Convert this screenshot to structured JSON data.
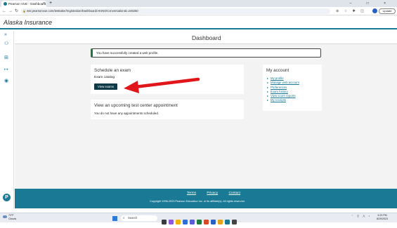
{
  "browser": {
    "tab_title": "Pearson VUE - Dashboard",
    "tab_close": "×",
    "new_tab": "+",
    "window_controls": "–  □  ×",
    "url": "wsr.pearsonvue.com/testtaker/registration/Dashboard/AKINS/ConversationId=246250",
    "update_label": "Update",
    "back": "←",
    "forward": "→",
    "reload": "↻",
    "toolbar_icons": "⊕ ☆ ✱ ◫"
  },
  "header": {
    "brand": "Alaska Insurance"
  },
  "sidebar": {
    "items": [
      "»",
      "⚇",
      "⊞",
      "↦",
      "◉"
    ],
    "logo": "P"
  },
  "page": {
    "title": "Dashboard"
  },
  "alert": {
    "text": "You have successfully created a web profile."
  },
  "schedule": {
    "heading": "Schedule an exam",
    "catalog": "Exam catalog",
    "button": "View exams"
  },
  "upcoming": {
    "heading": "View an upcoming test center appointment",
    "empty": "You do not have any appointments scheduled."
  },
  "account": {
    "heading": "My account",
    "links": [
      "My profile",
      "Manage web account",
      "Preferences",
      "Exam history",
      "View score reports",
      "My receipts"
    ]
  },
  "footer": {
    "links": [
      "Terms",
      "Privacy",
      "Contact"
    ],
    "copyright": "Copyright 1996-2023 Pearson Education Inc. or its affiliate(s). All rights reserved."
  },
  "taskbar": {
    "weather_temp": "72°F",
    "weather_desc": "Clouds",
    "search_placeholder": "Search",
    "clock_time": "3:23 PM",
    "clock_date": "8/29/2023"
  },
  "colors": {
    "brand": "#1a7a96",
    "button": "#0e3b47",
    "success": "#1e7a3c",
    "arrow": "#e0161b"
  }
}
